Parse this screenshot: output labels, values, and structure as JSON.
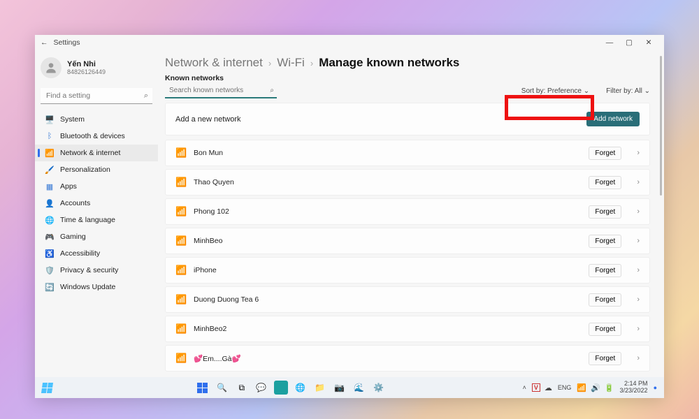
{
  "titlebar": {
    "app": "Settings"
  },
  "profile": {
    "name": "Yến Nhi",
    "sub": "84826126449"
  },
  "search": {
    "placeholder": "Find a setting"
  },
  "nav": {
    "items": [
      {
        "label": "System",
        "icon": "🖥️",
        "color": "#3a7bd5"
      },
      {
        "label": "Bluetooth & devices",
        "icon": "ᛒ",
        "color": "#3a7bd5"
      },
      {
        "label": "Network & internet",
        "icon": "📶",
        "color": "#3a7bd5",
        "active": true
      },
      {
        "label": "Personalization",
        "icon": "🖌️",
        "color": "#d68a2e"
      },
      {
        "label": "Apps",
        "icon": "▦",
        "color": "#3a7bd5"
      },
      {
        "label": "Accounts",
        "icon": "👤",
        "color": "#38a169"
      },
      {
        "label": "Time & language",
        "icon": "🌐",
        "color": "#d68a2e"
      },
      {
        "label": "Gaming",
        "icon": "🎮",
        "color": "#555"
      },
      {
        "label": "Accessibility",
        "icon": "♿",
        "color": "#3a7bd5"
      },
      {
        "label": "Privacy & security",
        "icon": "🛡️",
        "color": "#555"
      },
      {
        "label": "Windows Update",
        "icon": "🔄",
        "color": "#2a9d8f"
      }
    ]
  },
  "breadcrumbs": {
    "a": "Network & internet",
    "b": "Wi-Fi",
    "c": "Manage known networks"
  },
  "known": {
    "title": "Known networks",
    "search_placeholder": "Search known networks",
    "sort_label": "Sort by:",
    "sort_value": "Preference",
    "filter_label": "Filter by:",
    "filter_value": "All"
  },
  "addcard": {
    "text": "Add a new network",
    "button": "Add network"
  },
  "forget_label": "Forget",
  "networks": [
    {
      "name": "Bon Mun"
    },
    {
      "name": "Thao Quyen"
    },
    {
      "name": "Phong 102"
    },
    {
      "name": "MinhBeo"
    },
    {
      "name": "iPhone"
    },
    {
      "name": "Duong Duong Tea 6"
    },
    {
      "name": "MinhBeo2"
    },
    {
      "name": "💕Em....Gà💕"
    }
  ],
  "taskbar": {
    "tray": {
      "lang": "ENG"
    },
    "time": "2:14 PM",
    "date": "3/23/2022"
  }
}
